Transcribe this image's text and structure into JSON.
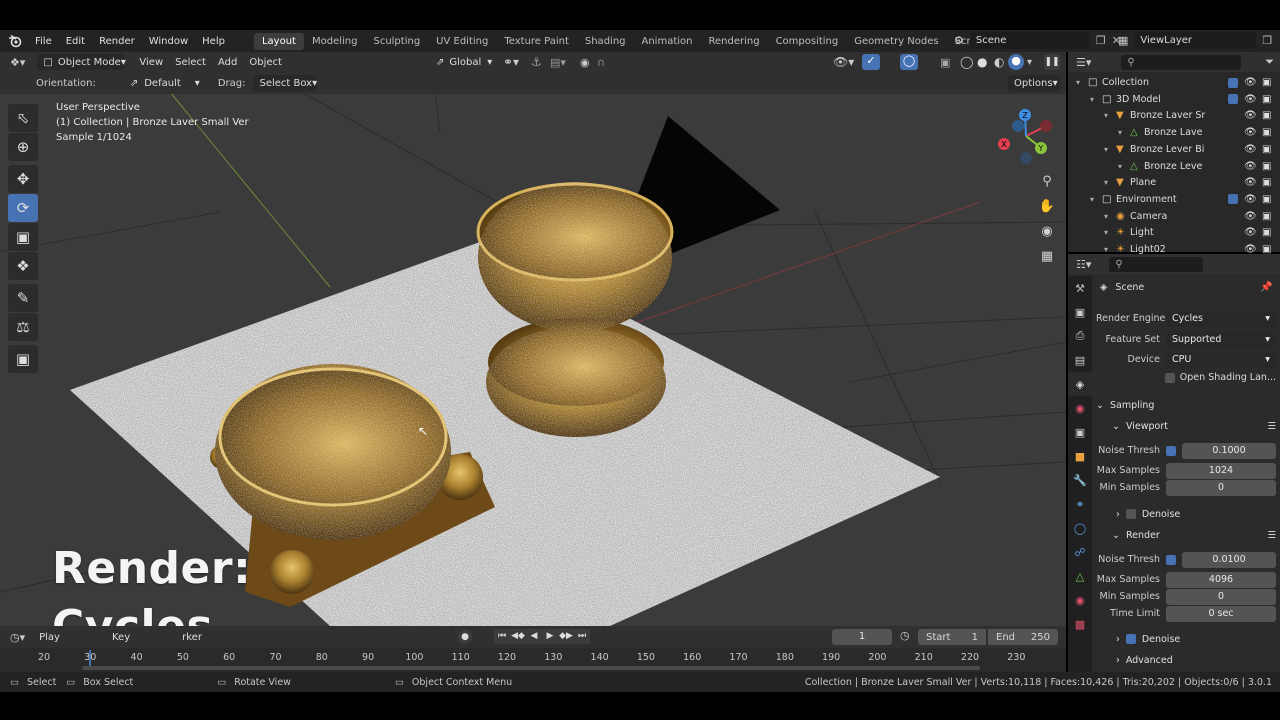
{
  "menu": {
    "items": [
      "File",
      "Edit",
      "Render",
      "Window",
      "Help"
    ],
    "workspaces": [
      "Layout",
      "Modeling",
      "Sculpting",
      "UV Editing",
      "Texture Paint",
      "Shading",
      "Animation",
      "Rendering",
      "Compositing",
      "Geometry Nodes",
      "Scripting"
    ],
    "active_workspace": "Layout",
    "add_tab": "+",
    "scene": "Scene",
    "view_layer": "ViewLayer"
  },
  "viewport_header": {
    "mode": "Object Mode",
    "menus": [
      "View",
      "Select",
      "Add",
      "Object"
    ],
    "transform_orientation": "Global"
  },
  "tool_settings": {
    "orientation_label": "Orientation:",
    "orientation_value": "Default",
    "drag_label": "Drag:",
    "drag_value": "Select Box",
    "options": "Options"
  },
  "viewport_overlay": {
    "line1": "User Perspective",
    "line2": "(1) Collection | Bronze Laver Small Ver",
    "line3": "Sample 1/1024"
  },
  "gizmo_axes": {
    "x": "X",
    "y": "Y",
    "z": "Z"
  },
  "caption": {
    "line1": "Render:",
    "line2": "Cycles"
  },
  "outliner": {
    "rows": [
      {
        "label": "Collection",
        "indent": 0
      },
      {
        "label": "3D Model",
        "indent": 1
      },
      {
        "label": "Bronze Laver Sr",
        "indent": 2
      },
      {
        "label": "Bronze Lave",
        "indent": 3
      },
      {
        "label": "Bronze Lever Bi",
        "indent": 2
      },
      {
        "label": "Bronze Leve",
        "indent": 3
      },
      {
        "label": "Plane",
        "indent": 2
      },
      {
        "label": "Environment",
        "indent": 1
      },
      {
        "label": "Camera",
        "indent": 2
      },
      {
        "label": "Light",
        "indent": 2
      },
      {
        "label": "Light02",
        "indent": 2
      }
    ]
  },
  "properties": {
    "context": "Scene",
    "render_engine_label": "Render Engine",
    "render_engine": "Cycles",
    "feature_set_label": "Feature Set",
    "feature_set": "Supported",
    "device_label": "Device",
    "device": "CPU",
    "open_shading": "Open Shading Lan...",
    "sampling": "Sampling",
    "viewport": "Viewport",
    "noise_thresh_label": "Noise Thresh",
    "vp_noise_thresh": "0.1000",
    "max_samples_label": "Max Samples",
    "vp_max_samples": "1024",
    "min_samples_label": "Min Samples",
    "vp_min_samples": "0",
    "denoise": "Denoise",
    "render": "Render",
    "r_noise_thresh": "0.0100",
    "r_max_samples": "4096",
    "r_min_samples": "0",
    "time_limit_label": "Time Limit",
    "time_limit": "0 sec",
    "advanced": "Advanced"
  },
  "timeline": {
    "playback": "Play",
    "keying": "Key",
    "marker": "rker",
    "current_frame": "1",
    "start_label": "Start",
    "start": "1",
    "end_label": "End",
    "end": "250",
    "ticks": [
      "20",
      "30",
      "40",
      "50",
      "60",
      "70",
      "80",
      "90",
      "100",
      "110",
      "120",
      "130",
      "140",
      "150",
      "160",
      "170",
      "180",
      "190",
      "200",
      "210",
      "220",
      "230"
    ]
  },
  "status": {
    "select": "Select",
    "box_select": "Box Select",
    "rotate_view": "Rotate View",
    "context_menu": "Object Context Menu",
    "stats": "Collection | Bronze Laver Small Ver | Verts:10,118 | Faces:10,426 | Tris:20,202 | Objects:0/6 | 3.0.1"
  },
  "colors": {
    "accent": "#4772b3",
    "bronze": "#b8903a",
    "x_axis": "#e0404f",
    "y_axis": "#8bc43c",
    "z_axis": "#3f8ee6"
  }
}
